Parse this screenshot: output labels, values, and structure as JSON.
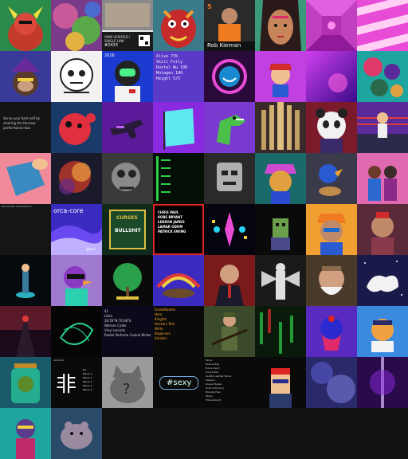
{
  "gallery": {
    "name_plate": "Rob Kiernan",
    "badge_number": "5",
    "stats_card": "Alive 73%\nSkill Fully\nDoxtal Wu 100\nMutagen 100\nHeight 5/5",
    "dark_note": "Serve your best self by clearing the Hermes performance box",
    "qr_caption": "OWN VERIFIED / SINGLE LINK",
    "qr_number": "#2433",
    "tile_small_label": "2016",
    "grey_card_label": "Bernadette Leah Marty 8",
    "orca_title": "orca-core",
    "orca_sub": "ghost",
    "curses_title": "CURSES",
    "curses_sub": "BULLSHIT",
    "names_list": "CHRIS PAUL\nKOBE BRYANT\nLEBRON JAMES\nLAMAR ODOM\nPATRICK EWING",
    "profile_lines": "41\nLibra\n28.59°N 76.06°E\nWoman Caller\nVinyl records\nRadiol Perfume Cookie Writer",
    "orange_lines": "SnakeNames\nHero\nKnights\nHackers Tom\nWrite\nBeginners\nSmaller",
    "sexy_tag": "#sexy",
    "small_list": "Fame\nRadius Bills\nHome Rand\nFuture Bob\nSoulful Leather Mode\nMarkers\nQueen Buster\nSolid Soft Army\nBroadly Fear\nStarly\nFollowship B",
    "kanji_char": "非",
    "kanji_title": "ARISAKA",
    "kanji_lines": "No.\nMinos 1\nMinos 2\nMinos 3\nMinos 4\nMinos 5"
  },
  "colors": {
    "accent_red": "#e02424",
    "accent_pink": "#e84bd6",
    "accent_purple": "#7b2cff",
    "accent_orange": "#ffa62b",
    "accent_teal": "#1fa5a0"
  }
}
